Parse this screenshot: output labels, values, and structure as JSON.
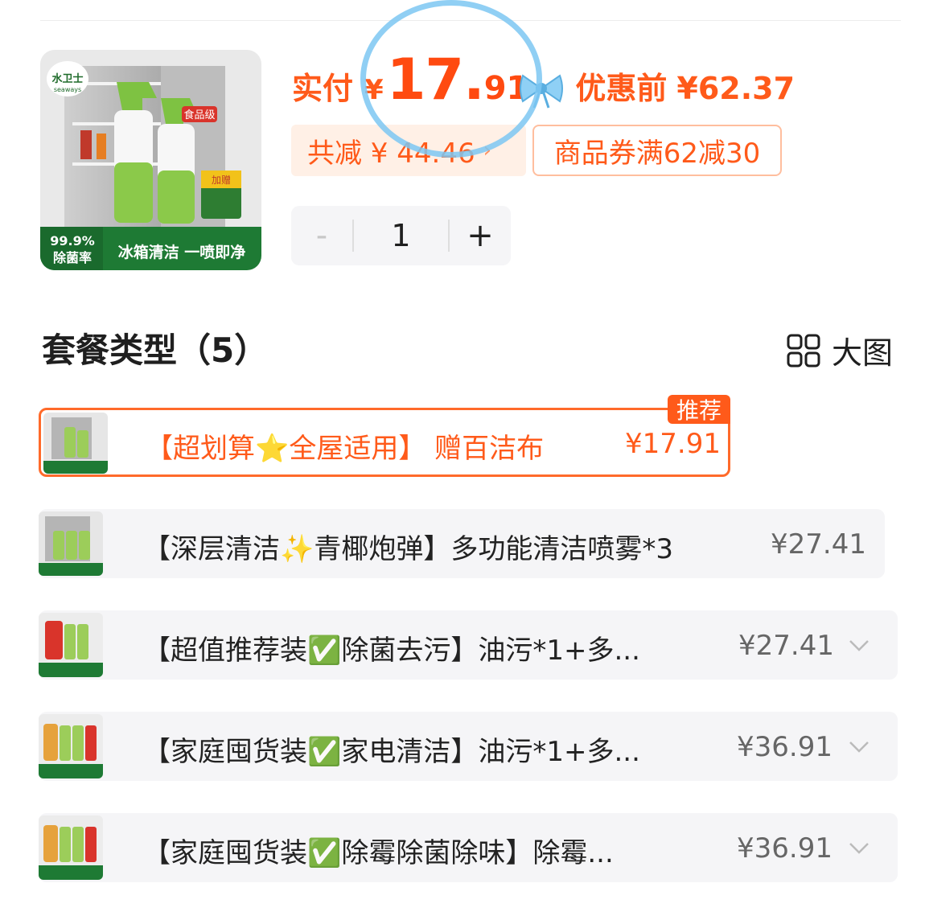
{
  "product": {
    "image_texts": {
      "brand": "水卫士",
      "brand_en": "seaways",
      "food_grade": "食品级",
      "gift": "加赠",
      "rate": "99.9%",
      "rate_label": "除菌率",
      "slogan": "冰箱清洁 一喷即净"
    }
  },
  "price": {
    "paid_label": "实付",
    "currency": "¥",
    "integer": "17.",
    "decimal": "91",
    "before_label": "优惠前",
    "before_value": "¥62.37",
    "saved_text": "共减 ¥ 44.46",
    "coupon_text": "商品券满62减30"
  },
  "stepper": {
    "minus": "-",
    "value": "1",
    "plus": "+"
  },
  "section": {
    "title": "套餐类型（5）",
    "bigview_label": "大图"
  },
  "options": [
    {
      "text": "【超划算⭐全屋适用】 赠百洁布",
      "price": "¥17.91",
      "badge": "推荐",
      "selected": true
    },
    {
      "text": "【深层清洁✨青椰炮弹】多功能清洁喷雾*3",
      "price": "¥27.41",
      "selected": false
    },
    {
      "text": "【超值推荐装✅除菌去污】油污*1+多...",
      "price": "¥27.41",
      "selected": false
    },
    {
      "text": "【家庭囤货装✅家电清洁】油污*1+多...",
      "price": "¥36.91",
      "selected": false
    },
    {
      "text": "【家庭囤货装✅除霉除菌除味】除霉...",
      "price": "¥36.91",
      "selected": false
    }
  ],
  "icons": [
    "bow-icon",
    "grid-icon",
    "chevron-down-icon"
  ],
  "colors": {
    "accent": "#ff5a1a",
    "chip_bg": "#fff0e6",
    "option_bg": "#f5f5f7",
    "highlight_circle": "#7cc7f2"
  }
}
